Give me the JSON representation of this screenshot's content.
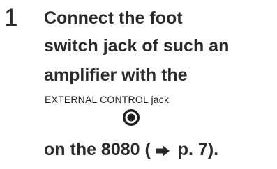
{
  "step": {
    "number": "1",
    "lines": [
      "Connect the foot",
      "switch jack of such an",
      "amplifier with the"
    ],
    "jack_label": "EXTERNAL CONTROL jack",
    "final_prefix": "on the 8080 (",
    "final_suffix": " p. 7)."
  },
  "icons": {
    "jack": "jack-connector-icon",
    "reference_arrow": "arrow-right-icon"
  }
}
